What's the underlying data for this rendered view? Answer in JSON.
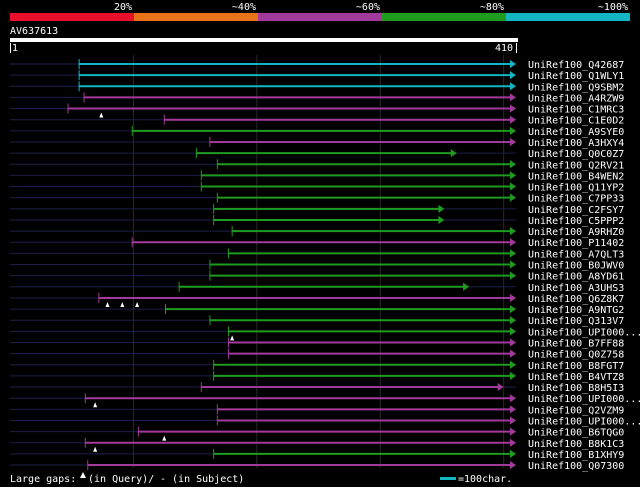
{
  "identity_legend": {
    "labels": [
      "20%",
      "~40%",
      "~60%",
      "~80%",
      "~100%"
    ],
    "colors": [
      "#e8102a",
      "#e87318",
      "#a23a9c",
      "#1f9c1f",
      "#12b5c2"
    ]
  },
  "query": {
    "id": "AV637613",
    "start": "1",
    "end": "410",
    "length": 410
  },
  "footer": {
    "large_gaps_text": "Large gaps:",
    "in_query_text": "(in Query)/",
    "in_subject_text": "- (in Subject)",
    "scale_text": "=100char."
  },
  "chart_data": {
    "type": "alignment-map",
    "query_length": 410,
    "hits": [
      {
        "name": "UniRef100_Q42687",
        "color": "#12b5c2",
        "start": 56,
        "end": 410,
        "gaps": []
      },
      {
        "name": "UniRef100_Q1WLY1",
        "color": "#12b5c2",
        "start": 56,
        "end": 410,
        "gaps": []
      },
      {
        "name": "UniRef100_Q9SBM2",
        "color": "#12b5c2",
        "start": 56,
        "end": 410,
        "gaps": []
      },
      {
        "name": "UniRef100_A4RZW9",
        "color": "#a23a9c",
        "start": 60,
        "end": 410,
        "gaps": []
      },
      {
        "name": "UniRef100_C1MRC3",
        "color": "#a23a9c",
        "start": 47,
        "end": 410,
        "gaps": [
          74
        ]
      },
      {
        "name": "UniRef100_C1E0D2",
        "color": "#a23a9c",
        "start": 125,
        "end": 410,
        "gaps": []
      },
      {
        "name": "UniRef100_A9SYE0",
        "color": "#1f9c1f",
        "start": 99,
        "end": 410,
        "gaps": []
      },
      {
        "name": "UniRef100_A3HXY4",
        "color": "#a23a9c",
        "start": 162,
        "end": 410,
        "gaps": []
      },
      {
        "name": "UniRef100_Q0C0Z7",
        "color": "#1f9c1f",
        "start": 151,
        "end": 362,
        "gaps": []
      },
      {
        "name": "UniRef100_Q2RV21",
        "color": "#1f9c1f",
        "start": 168,
        "end": 410,
        "gaps": []
      },
      {
        "name": "UniRef100_B4WEN2",
        "color": "#1f9c1f",
        "start": 155,
        "end": 410,
        "gaps": []
      },
      {
        "name": "UniRef100_Q11YP2",
        "color": "#1f9c1f",
        "start": 155,
        "end": 410,
        "gaps": []
      },
      {
        "name": "UniRef100_C7PP33",
        "color": "#1f9c1f",
        "start": 168,
        "end": 410,
        "gaps": []
      },
      {
        "name": "UniRef100_C2FSY7",
        "color": "#1f9c1f",
        "start": 165,
        "end": 352,
        "gaps": []
      },
      {
        "name": "UniRef100_C5PPP2",
        "color": "#1f9c1f",
        "start": 165,
        "end": 352,
        "gaps": []
      },
      {
        "name": "UniRef100_A9RHZ0",
        "color": "#1f9c1f",
        "start": 180,
        "end": 410,
        "gaps": []
      },
      {
        "name": "UniRef100_P11402",
        "color": "#a23a9c",
        "start": 99,
        "end": 410,
        "gaps": []
      },
      {
        "name": "UniRef100_A7QLT3",
        "color": "#1f9c1f",
        "start": 177,
        "end": 410,
        "gaps": []
      },
      {
        "name": "UniRef100_B0JWV0",
        "color": "#1f9c1f",
        "start": 162,
        "end": 410,
        "gaps": []
      },
      {
        "name": "UniRef100_A8YD61",
        "color": "#1f9c1f",
        "start": 162,
        "end": 410,
        "gaps": []
      },
      {
        "name": "UniRef100_A3UHS3",
        "color": "#1f9c1f",
        "start": 137,
        "end": 372,
        "gaps": []
      },
      {
        "name": "UniRef100_Q6Z8K7",
        "color": "#a23a9c",
        "start": 72,
        "end": 410,
        "gaps": [
          79,
          91,
          103
        ]
      },
      {
        "name": "UniRef100_A9NTG2",
        "color": "#1f9c1f",
        "start": 126,
        "end": 410,
        "gaps": []
      },
      {
        "name": "UniRef100_Q313V7",
        "color": "#1f9c1f",
        "start": 162,
        "end": 410,
        "gaps": []
      },
      {
        "name": "UniRef100_UPI000...",
        "color": "#1f9c1f",
        "start": 177,
        "end": 410,
        "gaps": [
          180
        ]
      },
      {
        "name": "UniRef100_B7FF88",
        "color": "#a23a9c",
        "start": 177,
        "end": 410,
        "gaps": []
      },
      {
        "name": "UniRef100_Q0Z758",
        "color": "#a23a9c",
        "start": 177,
        "end": 410,
        "gaps": []
      },
      {
        "name": "UniRef100_B8FGT7",
        "color": "#1f9c1f",
        "start": 165,
        "end": 410,
        "gaps": []
      },
      {
        "name": "UniRef100_B4VTZ8",
        "color": "#1f9c1f",
        "start": 165,
        "end": 410,
        "gaps": []
      },
      {
        "name": "UniRef100_B8H5I3",
        "color": "#a23a9c",
        "start": 155,
        "end": 400,
        "gaps": []
      },
      {
        "name": "UniRef100_UPI000...",
        "color": "#a23a9c",
        "start": 61,
        "end": 410,
        "gaps": [
          69
        ]
      },
      {
        "name": "UniRef100_Q2VZM9",
        "color": "#a23a9c",
        "start": 168,
        "end": 410,
        "gaps": []
      },
      {
        "name": "UniRef100_UPI000...",
        "color": "#a23a9c",
        "start": 168,
        "end": 410,
        "gaps": []
      },
      {
        "name": "UniRef100_B6TQG0",
        "color": "#a23a9c",
        "start": 104,
        "end": 410,
        "gaps": [
          125
        ]
      },
      {
        "name": "UniRef100_B8K1C3",
        "color": "#a23a9c",
        "start": 61,
        "end": 410,
        "gaps": [
          69
        ]
      },
      {
        "name": "UniRef100_B1XHY9",
        "color": "#1f9c1f",
        "start": 165,
        "end": 410,
        "gaps": []
      },
      {
        "name": "UniRef100_Q07300",
        "color": "#a23a9c",
        "start": 63,
        "end": 410,
        "gaps": []
      }
    ]
  }
}
